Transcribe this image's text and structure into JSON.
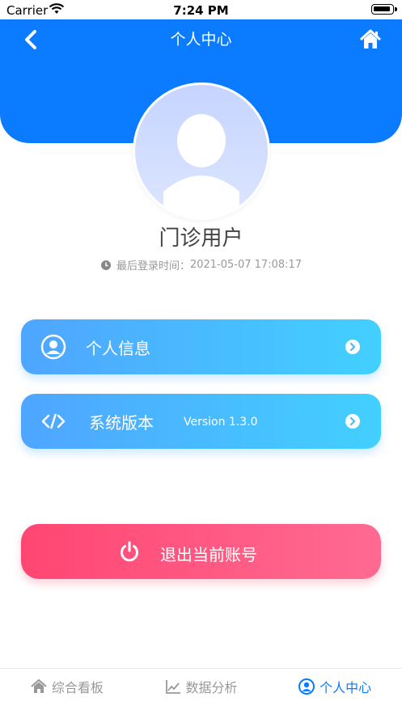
{
  "status_bar": {
    "carrier": "Carrier",
    "time": "7:24 PM"
  },
  "header": {
    "title": "个人中心",
    "back_icon": "chevron-left-icon",
    "home_icon": "home-icon"
  },
  "profile": {
    "name": "门诊用户",
    "last_login_label": "最后登录时间：",
    "last_login_time": "2021-05-07 17:08:17"
  },
  "menu": [
    {
      "label": "个人信息",
      "icon": "user-circle-icon"
    },
    {
      "label": "系统版本",
      "value": "Version 1.3.0",
      "icon": "code-icon"
    }
  ],
  "logout": {
    "label": "退出当前账号",
    "icon": "power-icon"
  },
  "tabbar": [
    {
      "label": "综合看板",
      "icon": "home-icon",
      "active": false
    },
    {
      "label": "数据分析",
      "icon": "line-chart-icon",
      "active": false
    },
    {
      "label": "个人中心",
      "icon": "user-circle-icon",
      "active": true
    }
  ],
  "colors": {
    "primary": "#0b7bff",
    "card_gradient_start": "#4fa5ff",
    "card_gradient_end": "#42d0ff",
    "logout_start": "#ff4673",
    "logout_end": "#ff6a92"
  }
}
